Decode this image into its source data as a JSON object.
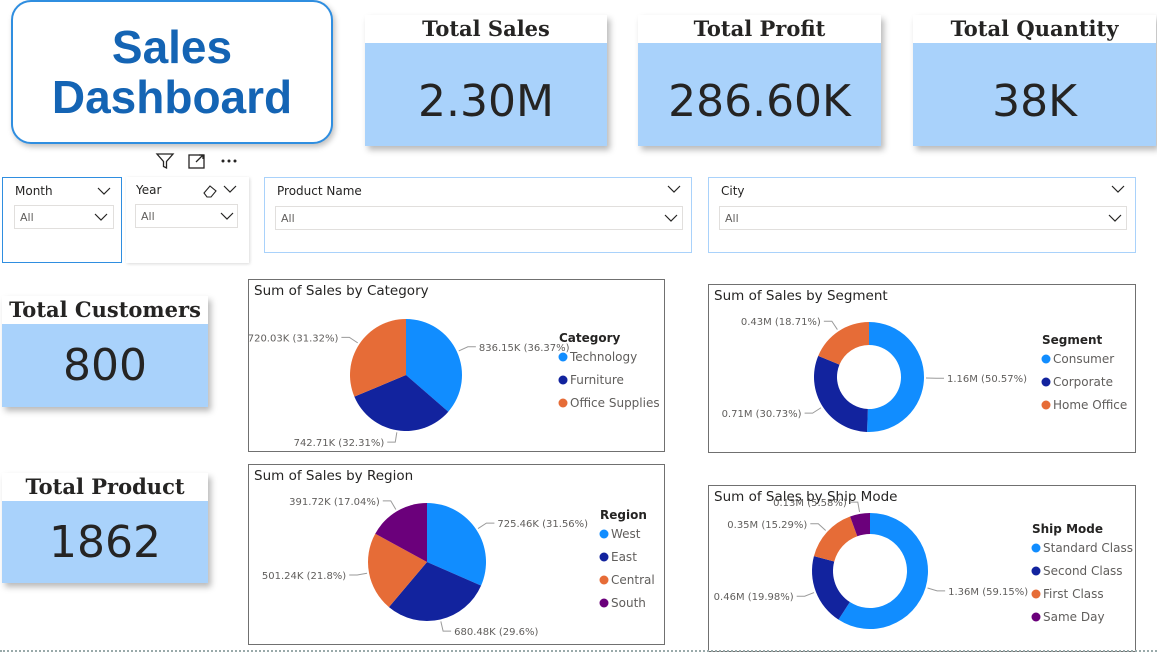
{
  "header": {
    "title_line1": "Sales",
    "title_line2": "Dashboard"
  },
  "kpis": {
    "total_sales": {
      "label": "Total Sales",
      "value": "2.30M"
    },
    "total_profit": {
      "label": "Total Profit",
      "value": "286.60K"
    },
    "total_quantity": {
      "label": "Total Quantity",
      "value": "38K"
    },
    "total_customers": {
      "label": "Total Customers",
      "value": "800"
    },
    "total_product": {
      "label": "Total Product",
      "value": "1862"
    }
  },
  "visual_header_icons": [
    "filter-icon",
    "focus-mode-icon",
    "more-options-icon"
  ],
  "slicers": {
    "month": {
      "label": "Month",
      "value": "All"
    },
    "year": {
      "label": "Year",
      "value": "All"
    },
    "product_name": {
      "label": "Product Name",
      "value": "All"
    },
    "city": {
      "label": "City",
      "value": "All"
    }
  },
  "chart_data": [
    {
      "type": "pie",
      "title": "Sum of Sales by Category",
      "legend_title": "Category",
      "legend_position": "right",
      "slices": [
        {
          "name": "Technology",
          "value": 836.15,
          "label": "836.15K (36.37%)",
          "color": "#118dff"
        },
        {
          "name": "Furniture",
          "value": 742.71,
          "label": "742.71K (32.31%)",
          "color": "#12239e"
        },
        {
          "name": "Office Supplies",
          "value": 720.03,
          "label": "720.03K (31.32%)",
          "color": "#e66c37"
        }
      ]
    },
    {
      "type": "donut",
      "title": "Sum of Sales by Segment",
      "legend_title": "Segment",
      "legend_position": "right",
      "slices": [
        {
          "name": "Consumer",
          "value": 50.57,
          "label": "1.16M (50.57%)",
          "color": "#118dff"
        },
        {
          "name": "Corporate",
          "value": 30.73,
          "label": "0.71M (30.73%)",
          "color": "#12239e"
        },
        {
          "name": "Home Office",
          "value": 18.71,
          "label": "0.43M (18.71%)",
          "color": "#e66c37"
        }
      ]
    },
    {
      "type": "pie",
      "title": "Sum of Sales by Region",
      "legend_title": "Region",
      "legend_position": "right",
      "slices": [
        {
          "name": "West",
          "value": 725.46,
          "label": "725.46K (31.56%)",
          "color": "#118dff"
        },
        {
          "name": "East",
          "value": 680.48,
          "label": "680.48K (29.6%)",
          "color": "#12239e"
        },
        {
          "name": "Central",
          "value": 501.24,
          "label": "501.24K (21.8%)",
          "color": "#e66c37"
        },
        {
          "name": "South",
          "value": 391.72,
          "label": "391.72K (17.04%)",
          "color": "#6b007b"
        }
      ]
    },
    {
      "type": "donut",
      "title": "Sum of Sales by Ship Mode",
      "legend_title": "Ship Mode",
      "legend_position": "right",
      "slices": [
        {
          "name": "Standard Class",
          "value": 59.15,
          "label": "1.36M (59.15%)",
          "color": "#118dff"
        },
        {
          "name": "Second Class",
          "value": 19.98,
          "label": "0.46M (19.98%)",
          "color": "#12239e"
        },
        {
          "name": "First Class",
          "value": 15.29,
          "label": "0.35M (15.29%)",
          "color": "#e66c37"
        },
        {
          "name": "Same Day",
          "value": 5.58,
          "label": "0.13M (5.58%)",
          "color": "#6b007b"
        }
      ]
    }
  ]
}
